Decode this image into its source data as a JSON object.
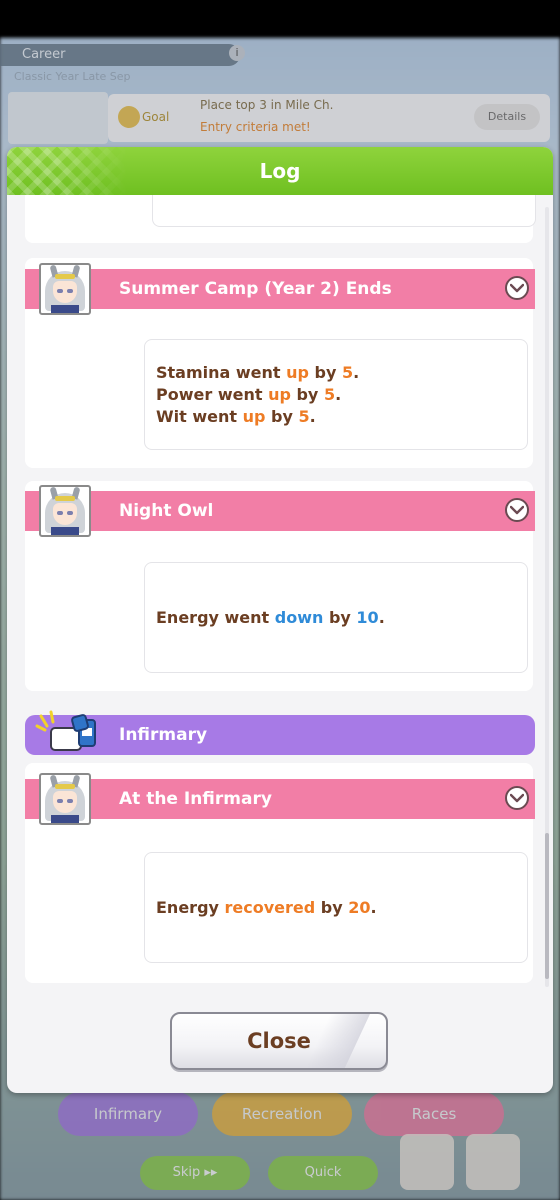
{
  "background": {
    "career_tab": "Career",
    "info_icon": "i",
    "class_label": "Classic Year Late Sep",
    "goal_label": "Goal",
    "goal_text": "Place top 3 in Mile Ch.",
    "goal_sub": "Entry criteria met!",
    "details_button": "Details",
    "bottom_buttons": [
      "Infirmary",
      "Recreation",
      "Races"
    ],
    "skip_button": "Skip ▸▸",
    "quick_button": "Quick",
    "log_tile": "Log"
  },
  "modal": {
    "title": "Log",
    "close_label": "Close"
  },
  "entries": [
    {
      "title": "Summer Camp (Year 2) Ends",
      "lines": [
        {
          "pre": "Stamina went ",
          "hl": "up",
          "mid": " by ",
          "num": "5",
          "post": "."
        },
        {
          "pre": "Power went ",
          "hl": "up",
          "mid": " by ",
          "num": "5",
          "post": "."
        },
        {
          "pre": "Wit went ",
          "hl": "up",
          "mid": " by ",
          "num": "5",
          "post": "."
        }
      ]
    },
    {
      "title": "Night Owl",
      "lines": [
        {
          "pre": "Energy went ",
          "hl": "down",
          "mid": " by ",
          "num": "10",
          "post": "."
        }
      ]
    },
    {
      "title": "Infirmary"
    },
    {
      "title": "At the Infirmary",
      "lines": [
        {
          "pre": "Energy ",
          "hl": "recovered",
          "mid": " by ",
          "num": "20",
          "post": "."
        }
      ]
    }
  ],
  "colors": {
    "header_green": "#7cc92c",
    "banner_pink": "#f27ea6",
    "banner_purple": "#a77ae6",
    "text_brown": "#6b3e22",
    "highlight_orange": "#ee7c25",
    "highlight_blue": "#2f8bd8"
  }
}
